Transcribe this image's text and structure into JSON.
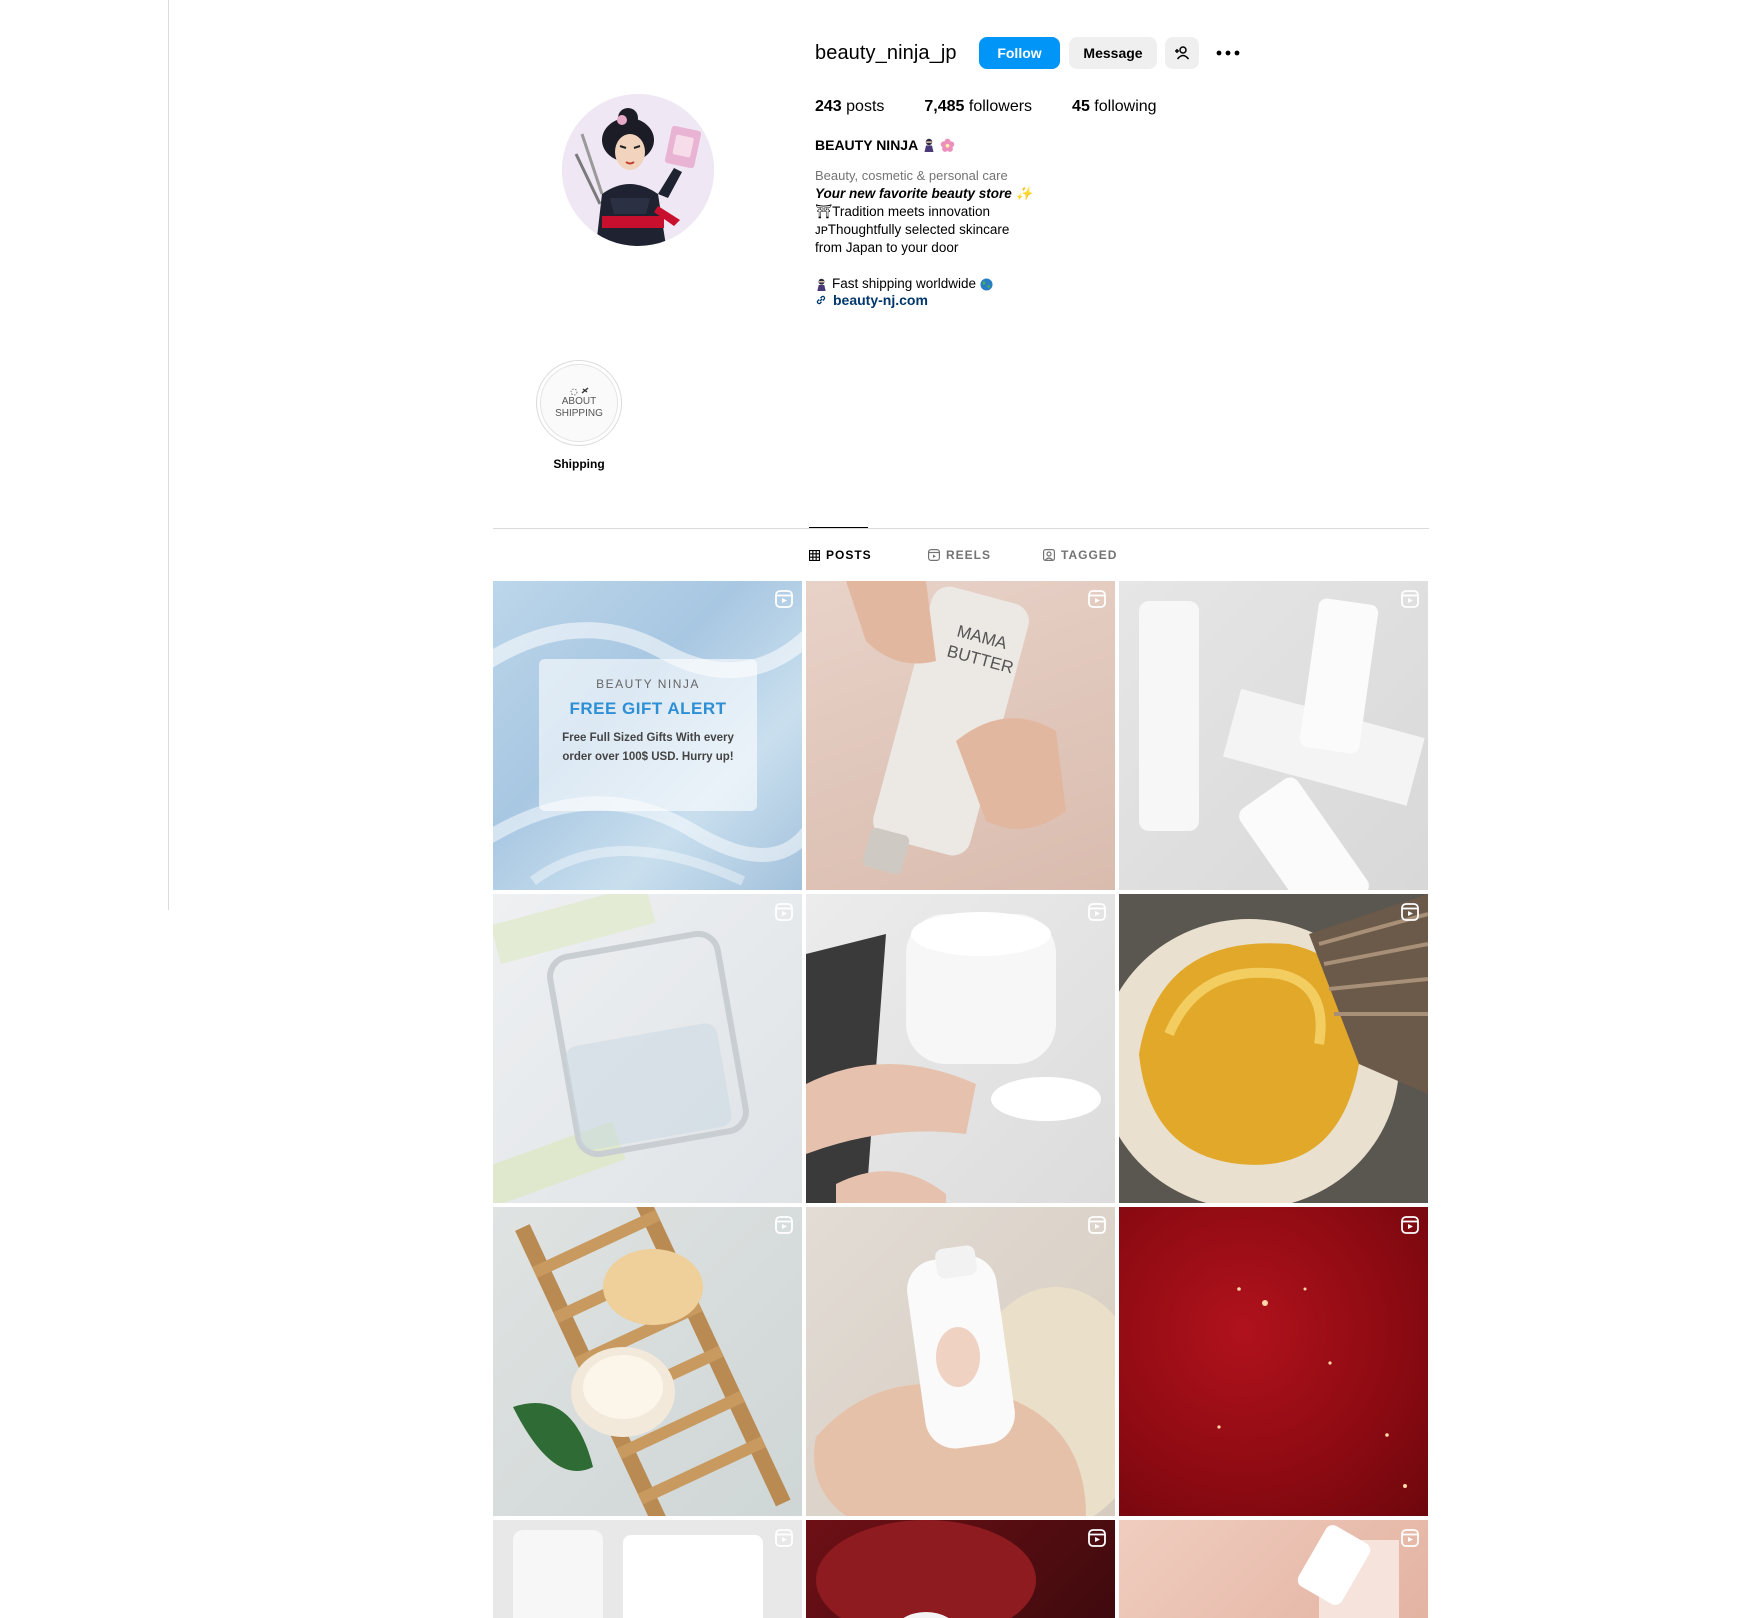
{
  "profile": {
    "username": "beauty_ninja_jp",
    "follow_label": "Follow",
    "message_label": "Message",
    "posts_count": "243",
    "posts_label": "posts",
    "followers_count": "7,485",
    "followers_label": "followers",
    "following_count": "45",
    "following_label": "following",
    "full_name": "BEAUTY NINJA",
    "category": "Beauty, cosmetic & personal care",
    "bio_tagline": "Your new favorite beauty store ✨",
    "bio_line1": "⛩Tradition meets innovation",
    "bio_line2": "ᴊᴘThoughtfully selected skincare",
    "bio_line3": "from Japan to your door",
    "bio_line4": "Fast shipping worldwide",
    "link": "beauty-nj.com"
  },
  "highlight": {
    "cover_line1": "ABOUT",
    "cover_line2": "SHIPPING",
    "label": "Shipping"
  },
  "tabs": {
    "posts": "POSTS",
    "reels": "REELS",
    "tagged": "TAGGED"
  },
  "promo": {
    "brand": "BEAUTY NINJA",
    "title": "FREE GIFT ALERT",
    "body": "Free Full Sized Gifts With every order over 100$ USD. Hurry up!"
  },
  "colors": {
    "accent": "#0095f6",
    "link": "#00376b",
    "secondary_text": "#737373"
  }
}
